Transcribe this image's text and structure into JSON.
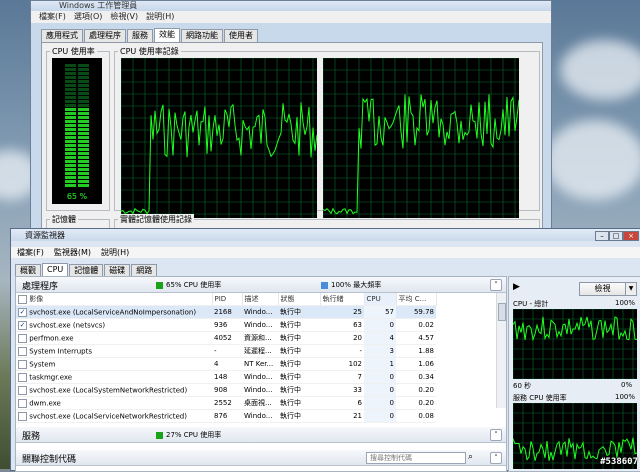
{
  "task_manager": {
    "title": "Windows 工作管理員",
    "menu": [
      "檔案(F)",
      "選項(O)",
      "檢視(V)",
      "說明(H)"
    ],
    "tabs": [
      "應用程式",
      "處理程序",
      "服務",
      "效能",
      "網路功能",
      "使用者"
    ],
    "active_tab": "效能",
    "cpu_usage_label": "CPU 使用率",
    "cpu_history_label": "CPU 使用率記錄",
    "cpu_percent_text": "65 %",
    "cpu_percent": 65,
    "memory_label": "記憶體",
    "memory_history_label": "實體記憶體使用記錄"
  },
  "resource_monitor": {
    "title": "資源監視器",
    "menu": [
      "檔案(F)",
      "監視器(M)",
      "說明(H)"
    ],
    "tabs": [
      "概觀",
      "CPU",
      "記憶體",
      "磁碟",
      "網路"
    ],
    "active_tab": "CPU",
    "processes": {
      "title": "處理程序",
      "cpu_badge": "65% CPU 使用率",
      "freq_badge": "100% 最大頻率",
      "columns": [
        "影像",
        "PID",
        "描述",
        "狀態",
        "執行緒",
        "CPU",
        "平均 C..."
      ],
      "rows": [
        {
          "checked": true,
          "image": "svchost.exe (LocalServiceAndNoImpersonation)",
          "pid": "2168",
          "desc": "Windo...",
          "status": "執行中",
          "threads": "25",
          "cpu": "57",
          "avg": "59.78"
        },
        {
          "checked": true,
          "image": "svchost.exe (netsvcs)",
          "pid": "936",
          "desc": "Windo...",
          "status": "執行中",
          "threads": "63",
          "cpu": "0",
          "avg": "0.02"
        },
        {
          "checked": false,
          "image": "perfmon.exe",
          "pid": "4052",
          "desc": "資源和...",
          "status": "執行中",
          "threads": "20",
          "cpu": "4",
          "avg": "4.57"
        },
        {
          "checked": false,
          "image": "System Interrupts",
          "pid": "-",
          "desc": "延遲程...",
          "status": "執行中",
          "threads": "-",
          "cpu": "3",
          "avg": "1.88"
        },
        {
          "checked": false,
          "image": "System",
          "pid": "4",
          "desc": "NT Ker...",
          "status": "執行中",
          "threads": "102",
          "cpu": "1",
          "avg": "1.06"
        },
        {
          "checked": false,
          "image": "taskmgr.exe",
          "pid": "148",
          "desc": "Windo...",
          "status": "執行中",
          "threads": "7",
          "cpu": "0",
          "avg": "0.34"
        },
        {
          "checked": false,
          "image": "svchost.exe (LocalSystemNetworkRestricted)",
          "pid": "908",
          "desc": "Windo...",
          "status": "執行中",
          "threads": "33",
          "cpu": "0",
          "avg": "0.20"
        },
        {
          "checked": false,
          "image": "dwm.exe",
          "pid": "2552",
          "desc": "桌面視...",
          "status": "執行中",
          "threads": "6",
          "cpu": "0",
          "avg": "0.20"
        },
        {
          "checked": false,
          "image": "svchost.exe (LocalServiceNetworkRestricted)",
          "pid": "876",
          "desc": "Windo...",
          "status": "執行中",
          "threads": "21",
          "cpu": "0",
          "avg": "0.08"
        }
      ]
    },
    "services": {
      "title": "服務",
      "cpu_badge": "27% CPU 使用率"
    },
    "handles": {
      "title": "關聯控制代碼",
      "search_placeholder": "搜尋控制代碼"
    },
    "side_panel": {
      "view_button": "檢視",
      "cpu_total_label": "CPU - 總計",
      "percent_100": "100%",
      "percent_0": "0%",
      "seconds_label": "60 秒",
      "service_cpu_label": "服務 CPU 使用率",
      "service_percent_100": "100%"
    }
  },
  "watermark": "#538607",
  "colors": {
    "graph_green": "#22ff22",
    "graph_grid": "#0a6b2c",
    "cpu_badge": "#1aa31a",
    "freq_badge": "#4a8ed9"
  }
}
